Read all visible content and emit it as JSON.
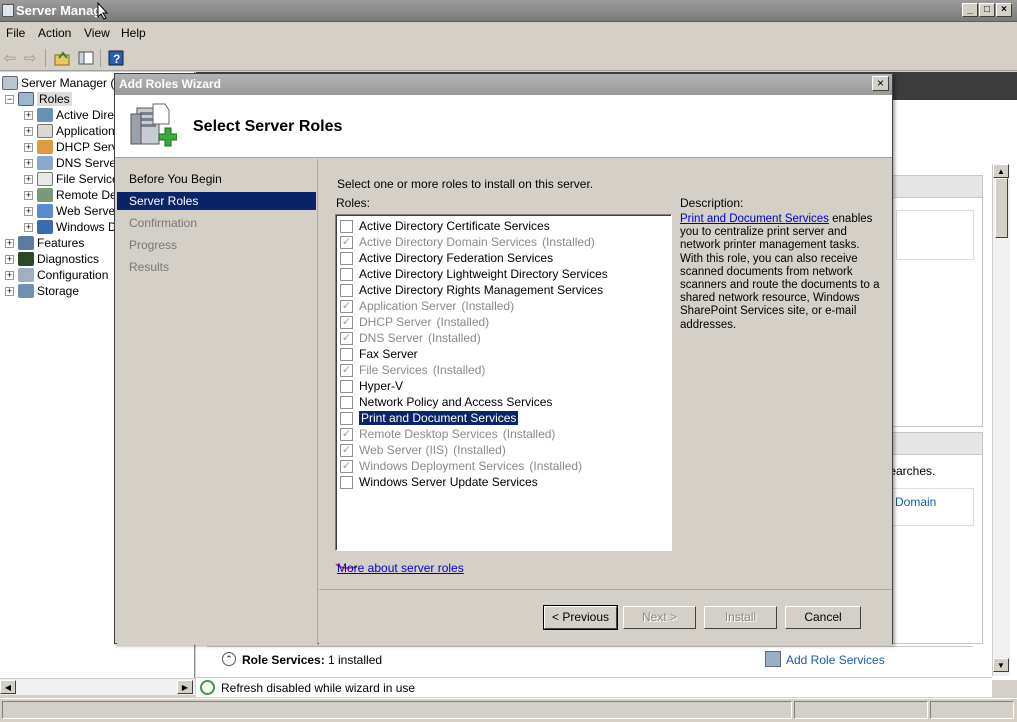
{
  "app": {
    "title": "Server Manag",
    "menu": [
      "File",
      "Action",
      "View",
      "Help"
    ],
    "window_buttons": [
      "_",
      "□",
      "×"
    ]
  },
  "tree": {
    "root": "Server Manager (SE",
    "roles": "Roles",
    "role_children": [
      "Active Direc",
      "Application",
      "DHCP Serve",
      "DNS Server",
      "File Service",
      "Remote Des",
      "Web Server",
      "Windows De"
    ],
    "others": [
      "Features",
      "Diagnostics",
      "Configuration",
      "Storage"
    ]
  },
  "background": {
    "search_text": "y searches.",
    "domain_link": "Domain",
    "role_services_label": "Role Services:",
    "role_services_value": "1 installed",
    "add_role_services": "Add Role Services",
    "status_text": "Refresh disabled while wizard in use"
  },
  "wizard": {
    "title": "Add Roles Wizard",
    "close": "×",
    "heading": "Select Server Roles",
    "nav": [
      "Before You Begin",
      "Server Roles",
      "Confirmation",
      "Progress",
      "Results"
    ],
    "nav_active": "Server Roles",
    "intro": "Select one or more roles to install on this server.",
    "roles_label": "Roles:",
    "roles": [
      {
        "name": "Active Directory Certificate Services",
        "status": "",
        "checked": false
      },
      {
        "name": "Active Directory Domain Services",
        "status": "(Installed)",
        "checked": true
      },
      {
        "name": "Active Directory Federation Services",
        "status": "",
        "checked": false
      },
      {
        "name": "Active Directory Lightweight Directory Services",
        "status": "",
        "checked": false
      },
      {
        "name": "Active Directory Rights Management Services",
        "status": "",
        "checked": false
      },
      {
        "name": "Application Server",
        "status": "(Installed)",
        "checked": true
      },
      {
        "name": "DHCP Server",
        "status": "(Installed)",
        "checked": true
      },
      {
        "name": "DNS Server",
        "status": "(Installed)",
        "checked": true
      },
      {
        "name": "Fax Server",
        "status": "",
        "checked": false
      },
      {
        "name": "File Services",
        "status": "(Installed)",
        "checked": true
      },
      {
        "name": "Hyper-V",
        "status": "",
        "checked": false
      },
      {
        "name": "Network Policy and Access Services",
        "status": "",
        "checked": false
      },
      {
        "name": "Print and Document Services",
        "status": "",
        "checked": false,
        "selected": true
      },
      {
        "name": "Remote Desktop Services",
        "status": "(Installed)",
        "checked": true
      },
      {
        "name": "Web Server (IIS)",
        "status": "(Installed)",
        "checked": true
      },
      {
        "name": "Windows Deployment Services",
        "status": "(Installed)",
        "checked": true
      },
      {
        "name": "Windows Server Update Services",
        "status": "",
        "checked": false
      }
    ],
    "description_label": "Description:",
    "description_link": "Print and Document Services",
    "description_body": " enables you to centralize print server and network printer management tasks. With this role, you can also receive scanned documents from network scanners and route the documents to a shared network resource, Windows SharePoint Services site, or e-mail addresses.",
    "more_link": "More about server roles",
    "buttons": {
      "previous": "< Previous",
      "next": "Next >",
      "install": "Install",
      "cancel": "Cancel"
    }
  },
  "colors": {
    "selection": "#0a246a",
    "link": "#0000cc",
    "dialog_face": "#d4d0c8"
  }
}
